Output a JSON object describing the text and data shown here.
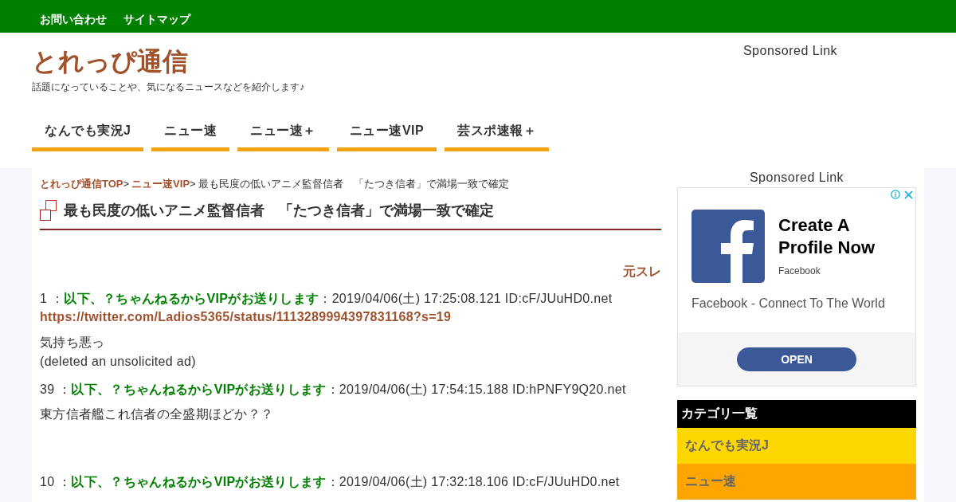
{
  "top_links": [
    "お問い合わせ",
    "サイトマップ"
  ],
  "site": {
    "title": "とれっぴ通信",
    "tagline": "話題になっていることや、気になるニュースなどを紹介します♪"
  },
  "header_sponsor": "Sponsored Link",
  "nav": [
    "なんでも実況J",
    "ニュー速",
    "ニュー速＋",
    "ニュー速VIP",
    "芸スポ速報＋"
  ],
  "breadcrumb": {
    "links": [
      "とれっぴ通信TOP",
      "ニュー速VIP"
    ],
    "separator": ">",
    "current": "最も民度の低いアニメ監督信者　「たつき信者」で満場一致で確定"
  },
  "article": {
    "title": "最も民度の低いアニメ監督信者　「たつき信者」で満場一致で確定",
    "source_link": "元スレ",
    "posts": [
      {
        "number": "1 ：",
        "name": "以下、？ちゃんねるからVIPがお送りします",
        "meta": "：2019/04/06(土) 17:25:08.121 ID:cF/JUuHD0.net",
        "link": "https://twitter.com/Ladios5365/status/1113289994397831168?s=19",
        "lines": [
          "気持ち悪っ",
          "(deleted an unsolicited ad)"
        ]
      },
      {
        "number": "39 ：",
        "name": "以下、？ちゃんねるからVIPがお送りします",
        "meta": "：2019/04/06(土) 17:54:15.188 ID:hPNFY9Q20.net",
        "lines": [
          "東方信者艦これ信者の全盛期ほどか？？"
        ]
      },
      {
        "number": "10 ：",
        "name": "以下、？ちゃんねるからVIPがお送りします",
        "meta": "：2019/04/06(土) 17:32:18.106 ID:cF/JUuHD0.net"
      }
    ]
  },
  "sidebar": {
    "sponsor": "Sponsored Link",
    "ad": {
      "headline": "Create A Profile Now",
      "advertiser": "Facebook",
      "description": "Facebook - Connect To The World",
      "button": "OPEN"
    },
    "categories_title": "カテゴリ一覧",
    "categories": [
      {
        "label": "なんでも実況J",
        "color": "#ffd700"
      },
      {
        "label": "ニュー速",
        "color": "#ffa500"
      }
    ]
  }
}
